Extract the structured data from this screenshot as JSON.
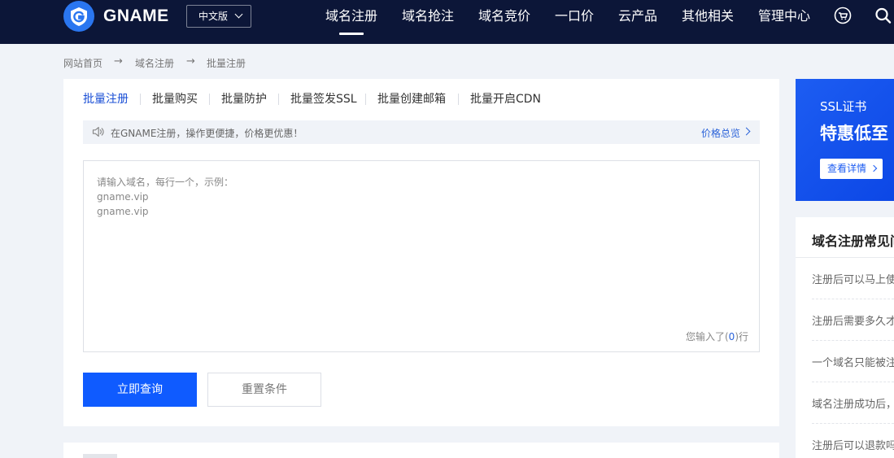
{
  "header": {
    "brand": "GNAME",
    "lang": "中文版",
    "nav": [
      "域名注册",
      "域名抢注",
      "域名竞价",
      "一口价",
      "云产品",
      "其他相关",
      "管理中心"
    ],
    "active_nav": "域名注册",
    "icons": [
      "logo-g-icon",
      "cart-icon",
      "search-icon"
    ]
  },
  "breadcrumb": {
    "items": [
      "网站首页",
      "域名注册",
      "批量注册"
    ],
    "separator": "→"
  },
  "tabs": [
    "批量注册",
    "批量购买",
    "批量防护",
    "批量签发SSL",
    "批量创建邮箱",
    "批量开启CDN"
  ],
  "notice": {
    "text": "在GNAME注册，操作更便捷，价格更优惠！",
    "link": "价格总览"
  },
  "domain_input": {
    "placeholder": "请输入域名，每行一个，示例：\ngname.vip\ngname.vip",
    "value": "",
    "counter_prefix": "您输入了(",
    "counter_value": "0",
    "counter_suffix": ")行"
  },
  "buttons": {
    "query": "立即查询",
    "reset": "重置条件"
  },
  "ssl_banner": {
    "title": "SSL证书",
    "headline": "特惠低至",
    "cta": "查看详情"
  },
  "faq": {
    "title": "域名注册常见问",
    "items": [
      "注册后可以马上使",
      "注册后需要多久才",
      "一个域名只能被注",
      "域名注册成功后，",
      "注册后可以退款吗"
    ]
  },
  "colors": {
    "header_bg": "#0c1638",
    "primary": "#0f5bff",
    "link": "#2a62d9",
    "page_bg": "#f0f3f8"
  }
}
